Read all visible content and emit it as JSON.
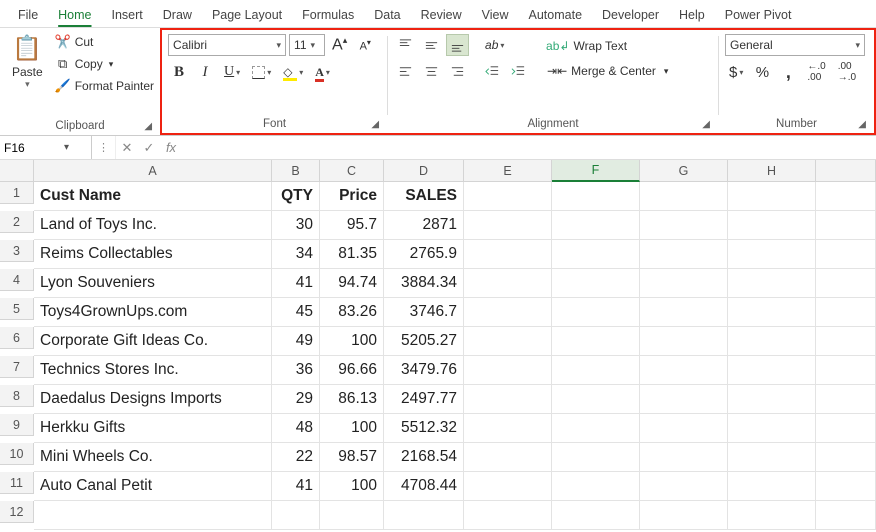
{
  "menu": [
    "File",
    "Home",
    "Insert",
    "Draw",
    "Page Layout",
    "Formulas",
    "Data",
    "Review",
    "View",
    "Automate",
    "Developer",
    "Help",
    "Power Pivot"
  ],
  "menu_active_index": 1,
  "ribbon": {
    "clipboard": {
      "label": "Clipboard",
      "paste": "Paste",
      "cut": "Cut",
      "copy": "Copy",
      "format_painter": "Format Painter"
    },
    "font": {
      "label": "Font",
      "name": "Calibri",
      "size": "11"
    },
    "alignment": {
      "label": "Alignment",
      "wrap": "Wrap Text",
      "merge": "Merge & Center"
    },
    "number": {
      "label": "Number",
      "format": "General"
    }
  },
  "namebox": "F16",
  "formula": "",
  "columns": [
    "A",
    "B",
    "C",
    "D",
    "E",
    "F",
    "G",
    "H"
  ],
  "selected_col_index": 5,
  "headers": [
    "Cust Name",
    "QTY",
    "Price",
    "SALES"
  ],
  "rows": [
    {
      "name": "Land of Toys Inc.",
      "qty": "30",
      "price": "95.7",
      "sales": "2871"
    },
    {
      "name": "Reims Collectables",
      "qty": "34",
      "price": "81.35",
      "sales": "2765.9"
    },
    {
      "name": "Lyon Souveniers",
      "qty": "41",
      "price": "94.74",
      "sales": "3884.34"
    },
    {
      "name": "Toys4GrownUps.com",
      "qty": "45",
      "price": "83.26",
      "sales": "3746.7"
    },
    {
      "name": "Corporate Gift Ideas Co.",
      "qty": "49",
      "price": "100",
      "sales": "5205.27"
    },
    {
      "name": "Technics Stores Inc.",
      "qty": "36",
      "price": "96.66",
      "sales": "3479.76"
    },
    {
      "name": "Daedalus Designs Imports",
      "qty": "29",
      "price": "86.13",
      "sales": "2497.77"
    },
    {
      "name": "Herkku Gifts",
      "qty": "48",
      "price": "100",
      "sales": "5512.32"
    },
    {
      "name": "Mini Wheels Co.",
      "qty": "22",
      "price": "98.57",
      "sales": "2168.54"
    },
    {
      "name": "Auto Canal Petit",
      "qty": "41",
      "price": "100",
      "sales": "4708.44"
    }
  ],
  "chart_data": {
    "type": "table",
    "columns": [
      "Cust Name",
      "QTY",
      "Price",
      "SALES"
    ],
    "data": [
      [
        "Land of Toys Inc.",
        30,
        95.7,
        2871
      ],
      [
        "Reims Collectables",
        34,
        81.35,
        2765.9
      ],
      [
        "Lyon Souveniers",
        41,
        94.74,
        3884.34
      ],
      [
        "Toys4GrownUps.com",
        45,
        83.26,
        3746.7
      ],
      [
        "Corporate Gift Ideas Co.",
        49,
        100,
        5205.27
      ],
      [
        "Technics Stores Inc.",
        36,
        96.66,
        3479.76
      ],
      [
        "Daedalus Designs Imports",
        29,
        86.13,
        2497.77
      ],
      [
        "Herkku Gifts",
        48,
        100,
        5512.32
      ],
      [
        "Mini Wheels Co.",
        22,
        98.57,
        2168.54
      ],
      [
        "Auto Canal Petit",
        41,
        100,
        4708.44
      ]
    ]
  }
}
